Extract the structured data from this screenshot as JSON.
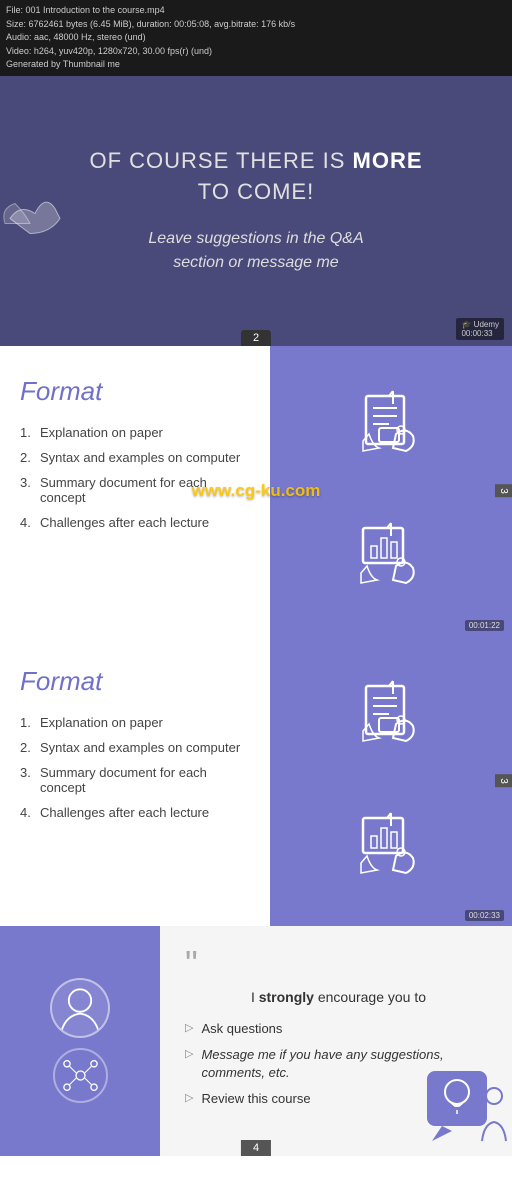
{
  "fileInfo": {
    "line1": "File: 001 Introduction to the course.mp4",
    "line2": "Size: 6762461 bytes (6.45 MiB), duration: 00:05:08, avg.bitrate: 176 kb/s",
    "line3": "Audio: aac, 48000 Hz, stereo (und)",
    "line4": "Video: h264, yuv420p, 1280x720, 30.00 fps(r) (und)",
    "line5": "Generated by Thumbnail me"
  },
  "videoSlide": {
    "mainText1": "OF COURSE THERE IS ",
    "mainTextBold": "MORE",
    "mainText2": "TO COME!",
    "subText1": "Leave suggestions in the ",
    "subTextItalic1": "Q&A",
    "subText2": "section or ",
    "subTextItalic2": "message me",
    "slideNumber": "2"
  },
  "formatSection1": {
    "title": "Format",
    "items": [
      {
        "num": "1.",
        "text": "Explanation on paper"
      },
      {
        "num": "2.",
        "text": "Syntax and examples on computer"
      },
      {
        "num": "3.",
        "text": "Summary document for each concept"
      },
      {
        "num": "4.",
        "text": "Challenges after each lecture"
      }
    ],
    "slideNum": "3",
    "timestamp": "00:01:22"
  },
  "formatSection2": {
    "title": "Format",
    "items": [
      {
        "num": "1.",
        "text": "Explanation on paper"
      },
      {
        "num": "2.",
        "text": "Syntax and examples on computer"
      },
      {
        "num": "3.",
        "text": "Summary document for each concept"
      },
      {
        "num": "4.",
        "text": "Challenges after each lecture"
      }
    ],
    "slideNum": "3",
    "timestamp": "00:02:33"
  },
  "watermark": "www.cg-ku.com",
  "quoteSection": {
    "quoteMark": "““",
    "mainTextPrefix": "I ",
    "mainTextBold": "strongly",
    "mainTextSuffix": " encourage you to",
    "listItems": [
      "Ask questions",
      "Message me if you have any suggestions, comments, etc.",
      "Review this course"
    ],
    "slideNumber": "4"
  },
  "colors": {
    "purple": "#7878cc",
    "darkBg": "#4a4a7a",
    "white": "#ffffff",
    "lightGray": "#f5f5f5"
  }
}
